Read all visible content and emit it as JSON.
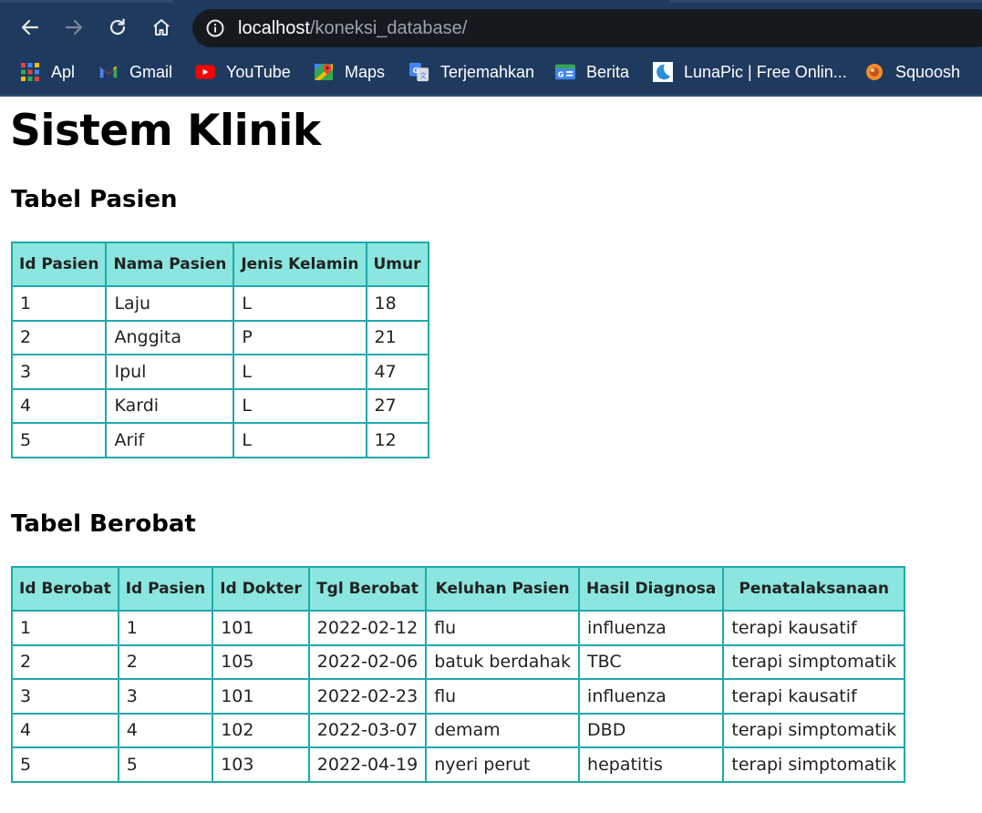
{
  "browser": {
    "url_host": "localhost",
    "url_path": "/koneksi_database/",
    "nav_icons": [
      "back-arrow-icon",
      "forward-arrow-icon",
      "reload-icon",
      "home-icon",
      "site-info-icon"
    ],
    "bookmarks": [
      {
        "label": "Apl",
        "icon": "apps-grid-icon"
      },
      {
        "label": "Gmail",
        "icon": "gmail-icon"
      },
      {
        "label": "YouTube",
        "icon": "youtube-icon"
      },
      {
        "label": "Maps",
        "icon": "maps-icon"
      },
      {
        "label": "Terjemahkan",
        "icon": "translate-icon"
      },
      {
        "label": "Berita",
        "icon": "news-icon"
      },
      {
        "label": "LunaPic | Free Onlin...",
        "icon": "lunapic-icon"
      },
      {
        "label": "Squoosh",
        "icon": "squoosh-icon"
      }
    ],
    "colors": {
      "chrome": "#1e3a5f",
      "omnibox": "#161a1f"
    }
  },
  "page": {
    "title": "Sistem Klinik",
    "table_border_color": "#1fa9ad",
    "table_header_color": "#8ae6de",
    "pasien": {
      "heading": "Tabel Pasien",
      "columns": [
        "Id Pasien",
        "Nama Pasien",
        "Jenis Kelamin",
        "Umur"
      ],
      "rows": [
        [
          "1",
          "Laju",
          "L",
          "18"
        ],
        [
          "2",
          "Anggita",
          "P",
          "21"
        ],
        [
          "3",
          "Ipul",
          "L",
          "47"
        ],
        [
          "4",
          "Kardi",
          "L",
          "27"
        ],
        [
          "5",
          "Arif",
          "L",
          "12"
        ]
      ]
    },
    "berobat": {
      "heading": "Tabel Berobat",
      "columns": [
        "Id Berobat",
        "Id Pasien",
        "Id Dokter",
        "Tgl Berobat",
        "Keluhan Pasien",
        "Hasil Diagnosa",
        "Penatalaksanaan"
      ],
      "rows": [
        [
          "1",
          "1",
          "101",
          "2022-02-12",
          "flu",
          "influenza",
          "terapi kausatif"
        ],
        [
          "2",
          "2",
          "105",
          "2022-02-06",
          "batuk berdahak",
          "TBC",
          "terapi simptomatik"
        ],
        [
          "3",
          "3",
          "101",
          "2022-02-23",
          "flu",
          "influenza",
          "terapi kausatif"
        ],
        [
          "4",
          "4",
          "102",
          "2022-03-07",
          "demam",
          "DBD",
          "terapi simptomatik"
        ],
        [
          "5",
          "5",
          "103",
          "2022-04-19",
          "nyeri perut",
          "hepatitis",
          "terapi simptomatik"
        ]
      ]
    }
  }
}
